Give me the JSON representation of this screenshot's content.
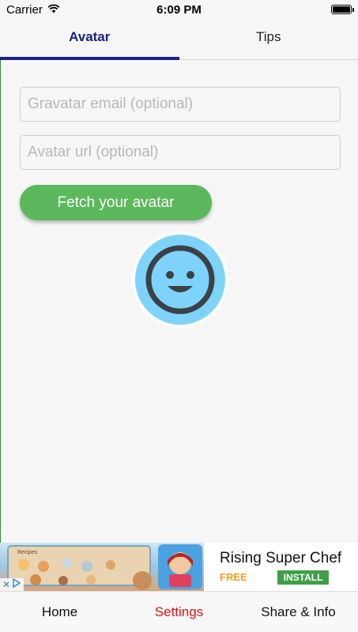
{
  "status_bar": {
    "carrier": "Carrier",
    "time": "6:09 PM"
  },
  "tabs": [
    {
      "label": "Avatar",
      "active": true
    },
    {
      "label": "Tips",
      "active": false
    }
  ],
  "form": {
    "email_placeholder": "Gravatar email (optional)",
    "email_value": "",
    "url_placeholder": "Avatar url (optional)",
    "url_value": "",
    "fetch_button_label": "Fetch your avatar"
  },
  "avatar": {
    "icon": "smiley-face-icon",
    "color": "#7ed3fa"
  },
  "ad": {
    "title": "Rising Super Chef",
    "price": "FREE",
    "install_label": "INSTALL",
    "game_screen_label": "Recipes"
  },
  "bottom_nav": [
    {
      "label": "Home",
      "active": false
    },
    {
      "label": "Settings",
      "active": true
    },
    {
      "label": "Share & Info",
      "active": false
    }
  ],
  "colors": {
    "accent": "#1a237e",
    "button": "#5cb85c",
    "active_nav": "#e01010",
    "install": "#3f9e48",
    "free": "#f0a020"
  }
}
